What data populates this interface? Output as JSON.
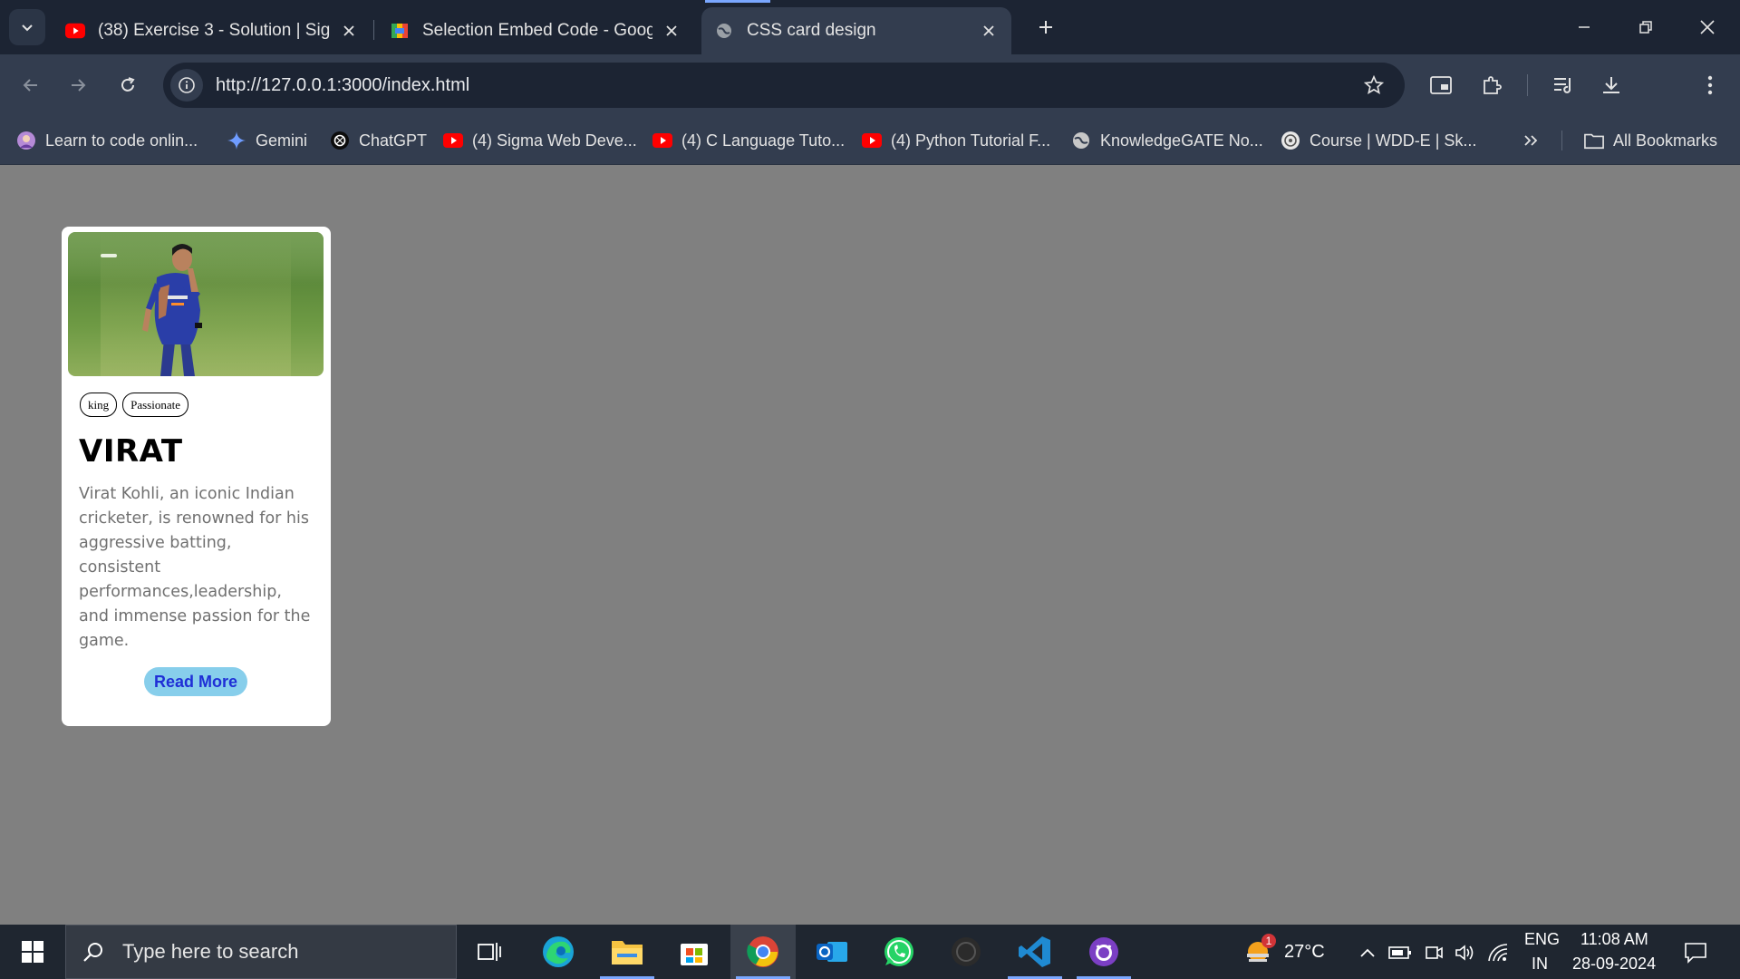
{
  "browser": {
    "tabs": [
      {
        "title": "(38) Exercise 3 - Solution | Sigm",
        "icon": "youtube-icon",
        "active": false
      },
      {
        "title": "Selection Embed Code - Google",
        "icon": "google-sheets-icon",
        "active": false
      },
      {
        "title": "CSS card design",
        "icon": "globe-icon",
        "active": true
      }
    ],
    "url": "http://127.0.0.1:3000/index.html",
    "bookmarks": [
      {
        "label": "Learn to code onlin...",
        "icon": "avatar-icon"
      },
      {
        "label": "Gemini",
        "icon": "gemini-icon"
      },
      {
        "label": "ChatGPT",
        "icon": "chatgpt-icon"
      },
      {
        "label": "(4) Sigma Web Deve...",
        "icon": "youtube-icon"
      },
      {
        "label": "(4) C Language Tuto...",
        "icon": "youtube-icon"
      },
      {
        "label": "(4) Python Tutorial F...",
        "icon": "youtube-icon"
      },
      {
        "label": "KnowledgeGATE No...",
        "icon": "globe-icon"
      },
      {
        "label": "Course | WDD-E | Sk...",
        "icon": "course-icon"
      }
    ],
    "all_bookmarks_label": "All Bookmarks"
  },
  "card": {
    "image_alt": "Virat Kohli celebrating on cricket field",
    "tags": [
      "king",
      "Passionate"
    ],
    "title": "VIRAT",
    "description": "Virat Kohli, an iconic Indian cricketer, is renowned for his aggressive batting, consistent performances,leadership, and immense passion for the game.",
    "button_label": "Read More"
  },
  "taskbar": {
    "search_placeholder": "Type here to search",
    "weather": "27°C",
    "weather_badge": "1",
    "lang_primary": "ENG",
    "lang_secondary": "IN",
    "time": "11:08 AM",
    "date": "28-09-2024"
  },
  "colors": {
    "tabstrip_bg": "#1c2433",
    "toolbar_bg": "#333d4f",
    "page_bg": "#808080",
    "button_bg": "#87ceeb",
    "button_text": "#1f2fd6",
    "taskbar_bg": "#1f2630"
  }
}
